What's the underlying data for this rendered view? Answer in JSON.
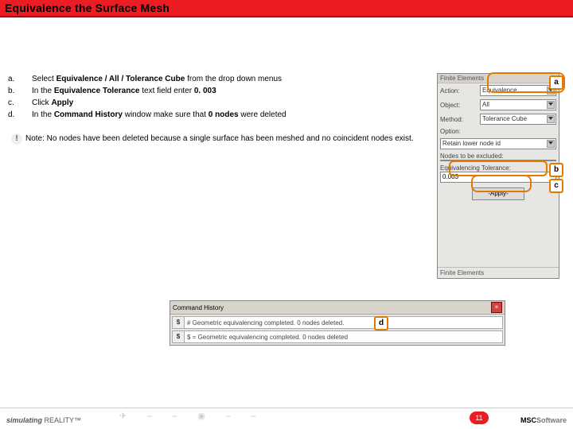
{
  "title": "Equivalence the Surface Mesh",
  "steps": {
    "a": {
      "letter": "a.",
      "t1": "Select ",
      "b": "Equivalence / All / Tolerance Cube ",
      "t2": "from the drop down menus"
    },
    "b": {
      "letter": "b.",
      "t1": "In the ",
      "b": "Equivalence Tolerance ",
      "t2": "text field enter ",
      "v": "0. 003"
    },
    "c": {
      "letter": "c.",
      "t1": "Click ",
      "b": "Apply"
    },
    "d": {
      "letter": "d.",
      "t1": "In the ",
      "b": "Command History ",
      "t2": "window make sure that ",
      "v": "0 nodes ",
      "t3": "were deleted"
    }
  },
  "note": "Note: No nodes have been deleted because a single surface has been meshed and no coincident nodes exist.",
  "panel": {
    "title": "Finite Elements",
    "action_label": "Action:",
    "action_value": "Equivalence",
    "object_label": "Object:",
    "object_value": "All",
    "method_label": "Method:",
    "method_value": "Tolerance Cube",
    "option_label": "Option:",
    "retain_label": "Retain lower node id",
    "exclude_label": "Nodes to be excluded:",
    "tol_label": "Equivalencing Tolerance:",
    "tol_value": "0.003",
    "apply": "-Apply-",
    "fe_title": "Finite Elements"
  },
  "cmd": {
    "title": "Command History",
    "line1": "# Geometric equivalencing completed. 0 nodes deleted.",
    "line2": "$ = Geometric equivalencing completed. 0 nodes deleted"
  },
  "call": {
    "a": "a",
    "b": "b",
    "c": "c",
    "d": "d"
  },
  "footer": {
    "sim": "simulating",
    "real": " REALITY™",
    "page": "11",
    "brand1": "MSC",
    "brand2": "Software"
  }
}
